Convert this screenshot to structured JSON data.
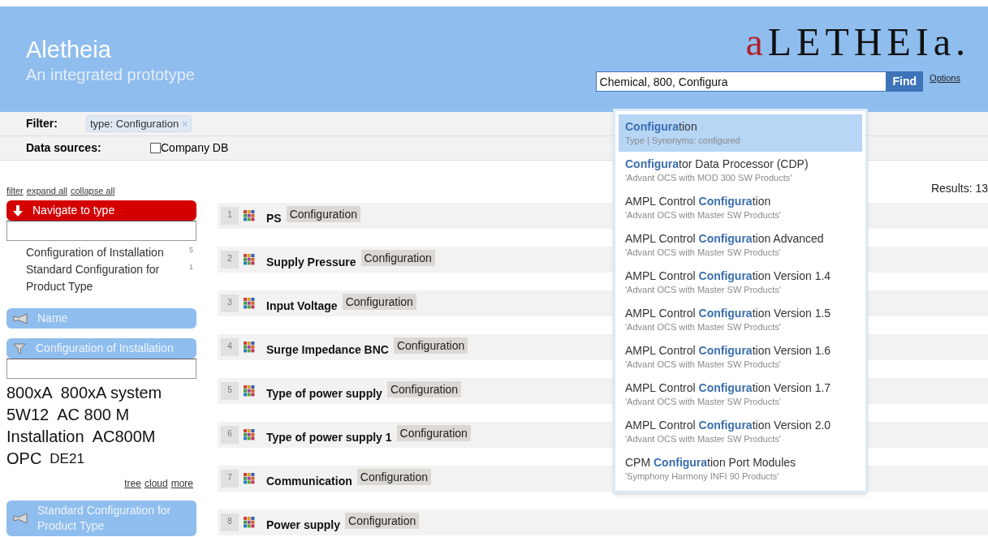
{
  "header": {
    "title": "Aletheia",
    "subtitle": "An integrated prototype",
    "logo": {
      "accent": "a",
      "rest": "LETHEIa."
    }
  },
  "search": {
    "value": "Chemical, 800, Configura",
    "button": "Find",
    "options_link": "Options"
  },
  "suggestions": [
    {
      "title": "**Configura**tion",
      "subtitle": "Type | Synonyms: configured",
      "selected": true
    },
    {
      "title": "**Configura**tor Data Processor (CDP)",
      "subtitle": "'Advant OCS with MOD 300 SW Products'",
      "selected": false
    },
    {
      "title": "AMPL Control **Configura**tion",
      "subtitle": "'Advant OCS with Master SW Products'",
      "selected": false
    },
    {
      "title": "AMPL Control **Configura**tion Advanced",
      "subtitle": "'Advant OCS with Master SW Products'",
      "selected": false
    },
    {
      "title": "AMPL Control **Configura**tion Version 1.4",
      "subtitle": "'Advant OCS with Master SW Products'",
      "selected": false
    },
    {
      "title": "AMPL Control **Configura**tion Version 1.5",
      "subtitle": "'Advant OCS with Master SW Products'",
      "selected": false
    },
    {
      "title": "AMPL Control **Configura**tion Version 1.6",
      "subtitle": "'Advant OCS with Master SW Products'",
      "selected": false
    },
    {
      "title": "AMPL Control **Configura**tion Version 1.7",
      "subtitle": "'Advant OCS with Master SW Products'",
      "selected": false
    },
    {
      "title": "AMPL Control **Configura**tion Version 2.0",
      "subtitle": "'Advant OCS with Master SW Products'",
      "selected": false
    },
    {
      "title": "CPM **Configura**tion Port Modules",
      "subtitle": "'Symphony Harmony INFI 90 Products'",
      "selected": false
    }
  ],
  "filter": {
    "label": "Filter:",
    "chip": "type: Configuration",
    "remove": "×"
  },
  "data_sources": {
    "label": "Data sources:",
    "options": [
      {
        "label": "Company DB",
        "checked": false
      }
    ]
  },
  "toolbar_links": [
    "filter",
    "expand all",
    "collapse all"
  ],
  "results_count": "Results: 13",
  "sidebar": [
    {
      "kind": "navigate",
      "title": "Navigate to type",
      "expanded": true,
      "items": [
        {
          "label": "Configuration of Installation",
          "count": "5"
        },
        {
          "label": "Standard Configuration for Product Type",
          "count": "1"
        }
      ]
    },
    {
      "kind": "facet",
      "title": "Name",
      "expanded": false
    },
    {
      "kind": "facet",
      "title": "Configuration of Installation",
      "expanded": true,
      "cloud": [
        {
          "text": "800xA",
          "large": true
        },
        {
          "text": "800xA system",
          "large": true
        },
        {
          "text": "5W12",
          "large": true
        },
        {
          "text": "AC 800 M",
          "large": true
        },
        {
          "text": "Installation",
          "large": true
        },
        {
          "text": "AC800M",
          "large": true
        },
        {
          "text": "OPC",
          "large": true
        },
        {
          "text": "DE21",
          "large": false
        }
      ],
      "links": [
        "tree",
        "cloud",
        "more"
      ]
    },
    {
      "kind": "facet",
      "title": "Standard Configuration for Product Type",
      "expanded": false
    }
  ],
  "results": [
    {
      "number": "1",
      "title": "PS",
      "type": "Configuration"
    },
    {
      "number": "2",
      "title": "Supply Pressure",
      "type": "Configuration"
    },
    {
      "number": "3",
      "title": "Input Voltage",
      "type": "Configuration"
    },
    {
      "number": "4",
      "title": "Surge Impedance BNC",
      "type": "Configuration"
    },
    {
      "number": "5",
      "title": "Type of power supply",
      "type": "Configuration"
    },
    {
      "number": "6",
      "title": "Type of power supply 1",
      "type": "Configuration"
    },
    {
      "number": "7",
      "title": "Communication",
      "type": "Configuration"
    },
    {
      "number": "8",
      "title": "Power supply",
      "type": "Configuration"
    }
  ]
}
